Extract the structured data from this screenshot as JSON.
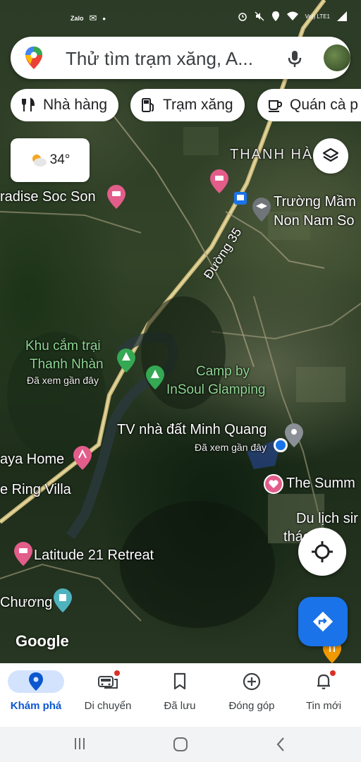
{
  "status_bar": {
    "left_icons": [
      "zalo-icon",
      "messenger-icon",
      "dot-icon"
    ],
    "left_texts": [
      "Zalo",
      "✉",
      "•"
    ],
    "right_icons": [
      "alarm-icon",
      "mute-icon",
      "location-icon",
      "wifi-icon",
      "signal-icon"
    ],
    "network_label": "Vo)) LTE1"
  },
  "search": {
    "placeholder": "Thử tìm trạm xăng, A..."
  },
  "chips": [
    {
      "label": "Nhà hàng",
      "icon": "fork-knife-icon"
    },
    {
      "label": "Trạm xăng",
      "icon": "gas-station-icon"
    },
    {
      "label": "Quán cà p",
      "icon": "coffee-cup-icon"
    }
  ],
  "weather": {
    "temp": "34°",
    "icon": "partly-cloudy-icon"
  },
  "map_labels": {
    "thanh_ha": "THANH HÀ",
    "paradise": "radise Soc Son",
    "truong_mam": "Trường Mầm",
    "non_nam_so": "Non Nam So",
    "duong35": "Đường 35",
    "khu_cam_trai_1": "Khu cắm trại",
    "khu_cam_trai_2": "Thanh Nhàn",
    "khu_seen": "Đã xem gần đây",
    "glamping_1": "Camp by",
    "glamping_2": "InSoul Glamping",
    "tv_nha_dat": "TV nhà đất Minh Quang",
    "tv_seen": "Đã xem gần đây",
    "aya_home": "aya Home",
    "ring_villa": "e Ring Villa",
    "summit": "The Summ",
    "du_lich_1": "Du lịch sir",
    "du_lich_2": "thác Rồ",
    "latitude": "Latitude 21 Retreat",
    "chuong": "Chương"
  },
  "google_logo": "Google",
  "bottom_nav": [
    {
      "label": "Khám phá",
      "icon": "explore-pin-icon",
      "active": true
    },
    {
      "label": "Di chuyển",
      "icon": "commute-car-icon",
      "active": false,
      "badge": true
    },
    {
      "label": "Đã lưu",
      "icon": "bookmark-icon",
      "active": false
    },
    {
      "label": "Đóng góp",
      "icon": "add-circle-icon",
      "active": false
    },
    {
      "label": "Tin mới",
      "icon": "bell-icon",
      "active": false,
      "badge": true
    }
  ],
  "colors": {
    "accent": "#1a73e8",
    "marker_pink": "#e35d8a",
    "marker_green": "#34a853",
    "marker_gray": "#70757a",
    "location_blue": "#1a73e8",
    "nav_active_bg": "#d3e3fd",
    "nav_active_text": "#0b57d0"
  }
}
